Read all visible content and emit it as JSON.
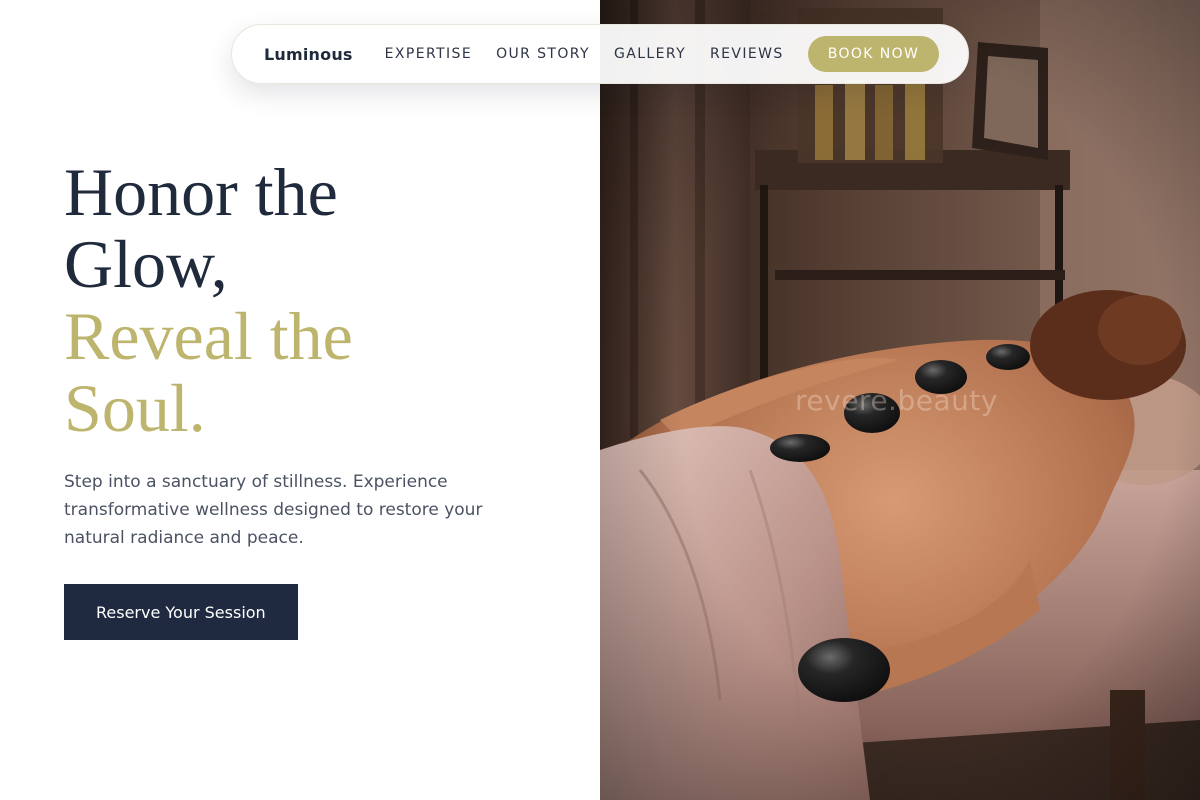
{
  "nav": {
    "brand": "Luminous",
    "links": [
      {
        "label": "EXPERTISE"
      },
      {
        "label": "OUR STORY"
      },
      {
        "label": "GALLERY"
      },
      {
        "label": "REVIEWS"
      }
    ],
    "book_label": "BOOK NOW"
  },
  "hero": {
    "headline_line1": "Honor the",
    "headline_line2": "Glow,",
    "headline_accent1": "Reveal the",
    "headline_accent2": "Soul.",
    "subtext": "Step into a sanctuary of stillness. Experience transformative wellness designed to restore your natural radiance and peace.",
    "cta_label": "Reserve Your Session"
  },
  "photo": {
    "watermark": "revere.beauty"
  },
  "colors": {
    "navy": "#1f2a3c",
    "gold_accent": "#bdb56e",
    "body_text": "#4a5263"
  }
}
